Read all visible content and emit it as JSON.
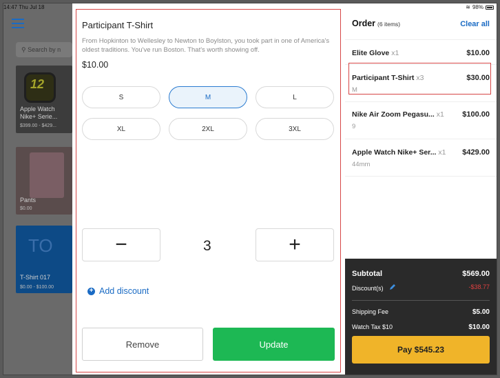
{
  "status_bar": {
    "time_date": "14:47  Thu Jul 18",
    "battery": "98%"
  },
  "catalog": {
    "search_placeholder": "Search by n",
    "tiles": [
      {
        "title": "Apple Watch Nike+ Serie...",
        "price": "$399.00 - $429..."
      },
      {
        "title": "Pants",
        "price": "$0.00"
      },
      {
        "initials": "TO",
        "title": "T-Shirt 017",
        "price": "$0.00 - $100.00"
      }
    ],
    "watch_face_text": "12"
  },
  "modal": {
    "title": "Participant T-Shirt",
    "description": "From Hopkinton to Wellesley to Newton to Boylston, you took part in one of America's oldest traditions. You've run Boston. That's worth showing off.",
    "price": "$10.00",
    "sizes": [
      "S",
      "M",
      "L",
      "XL",
      "2XL",
      "3XL"
    ],
    "selected_size": "M",
    "quantity": "3",
    "decrement_symbol": "−",
    "increment_symbol": "+",
    "add_discount": "Add discount",
    "remove": "Remove",
    "update": "Update"
  },
  "order": {
    "title": "Order",
    "count_label": "(6 items)",
    "clear_all": "Clear all",
    "items": [
      {
        "name": "Elite Glove",
        "qty": "x1",
        "sub": "",
        "price": "$10.00"
      },
      {
        "name": "Participant T-Shirt",
        "qty": "x3",
        "sub": "M",
        "price": "$30.00"
      },
      {
        "name": "Nike Air Zoom Pegasu...",
        "qty": "x1",
        "sub": "9",
        "price": "$100.00"
      },
      {
        "name": "Apple Watch Nike+ Ser...",
        "qty": "x1",
        "sub": "44mm",
        "price": "$429.00"
      }
    ],
    "subtotal_label": "Subtotal",
    "subtotal": "$569.00",
    "discount_label": "Discount(s)",
    "discount": "-$38.77",
    "shipping_label": "Shipping Fee",
    "shipping": "$5.00",
    "tax_label": "Watch Tax $10",
    "tax": "$10.00",
    "pay": "Pay $545.23"
  },
  "colors": {
    "accent": "#1a6bc4",
    "update_green": "#1db854",
    "pay_yellow": "#f0b429",
    "discount_red": "#e04040",
    "highlight": "#d64545"
  }
}
